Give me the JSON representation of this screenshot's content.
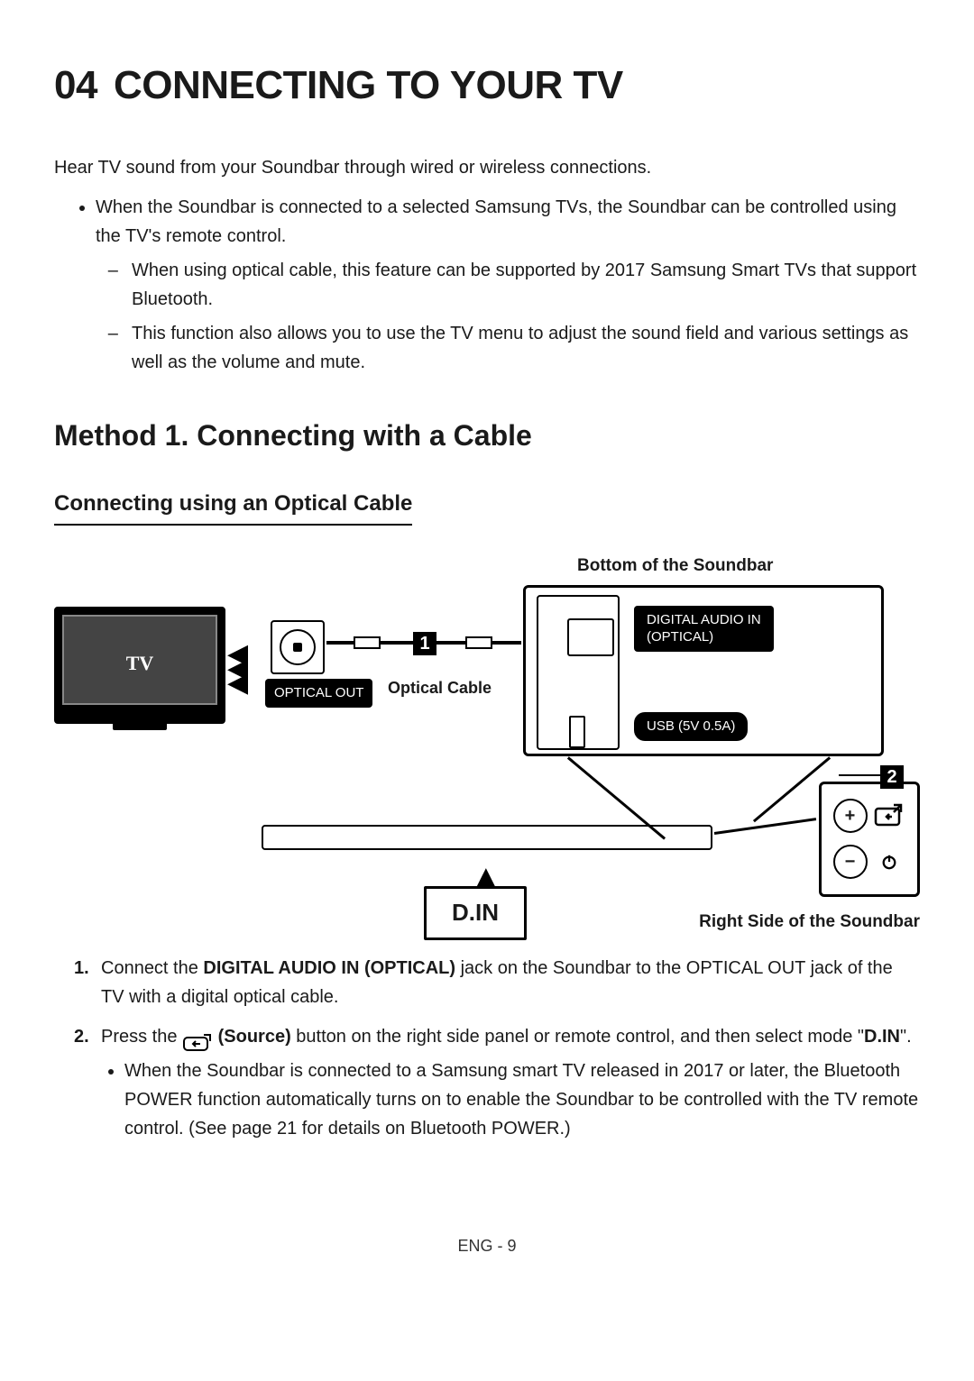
{
  "chapter_number": "04",
  "chapter_title": "CONNECTING TO YOUR TV",
  "intro": "Hear TV sound from your Soundbar through wired or wireless connections.",
  "bullets": [
    {
      "text": "When the Soundbar is connected to a selected Samsung TVs, the Soundbar can be controlled using the TV's remote control.",
      "subs": [
        "When using optical cable, this feature can be supported by 2017 Samsung Smart TVs that support Bluetooth.",
        "This function also allows you to use the TV menu to adjust the sound field and various settings as well as the volume and mute."
      ]
    }
  ],
  "method_heading": "Method 1. Connecting with a Cable",
  "sub_heading": "Connecting using an Optical Cable",
  "diagram": {
    "top_caption": "Bottom of the Soundbar",
    "bottom_caption": "Right Side of the Soundbar",
    "tv_label": "TV",
    "optical_out": "OPTICAL OUT",
    "cable_label": "Optical Cable",
    "callout_1": "1",
    "callout_2": "2",
    "port_digital_audio_in": "DIGITAL AUDIO IN\n(OPTICAL)",
    "port_usb": "USB (5V 0.5A)",
    "din": "D.IN",
    "side_buttons": {
      "plus": "+",
      "minus": "−"
    }
  },
  "steps": [
    {
      "num": "1.",
      "pre": "Connect the ",
      "bold": "DIGITAL AUDIO IN (OPTICAL)",
      "post": " jack on the Soundbar to the OPTICAL OUT jack of the TV with a digital optical cable."
    },
    {
      "num": "2.",
      "pre": "Press the ",
      "bold": "(Source)",
      "post": " button on the right side panel or remote control, and then select mode \"",
      "bold2": "D.IN",
      "post2": "\".",
      "subbullets": [
        "When the Soundbar is connected to a Samsung smart TV released in 2017 or later, the Bluetooth POWER function automatically turns on to enable the Soundbar to be controlled with the TV remote control. (See page 21 for details on Bluetooth POWER.)"
      ]
    }
  ],
  "footer": "ENG - 9"
}
